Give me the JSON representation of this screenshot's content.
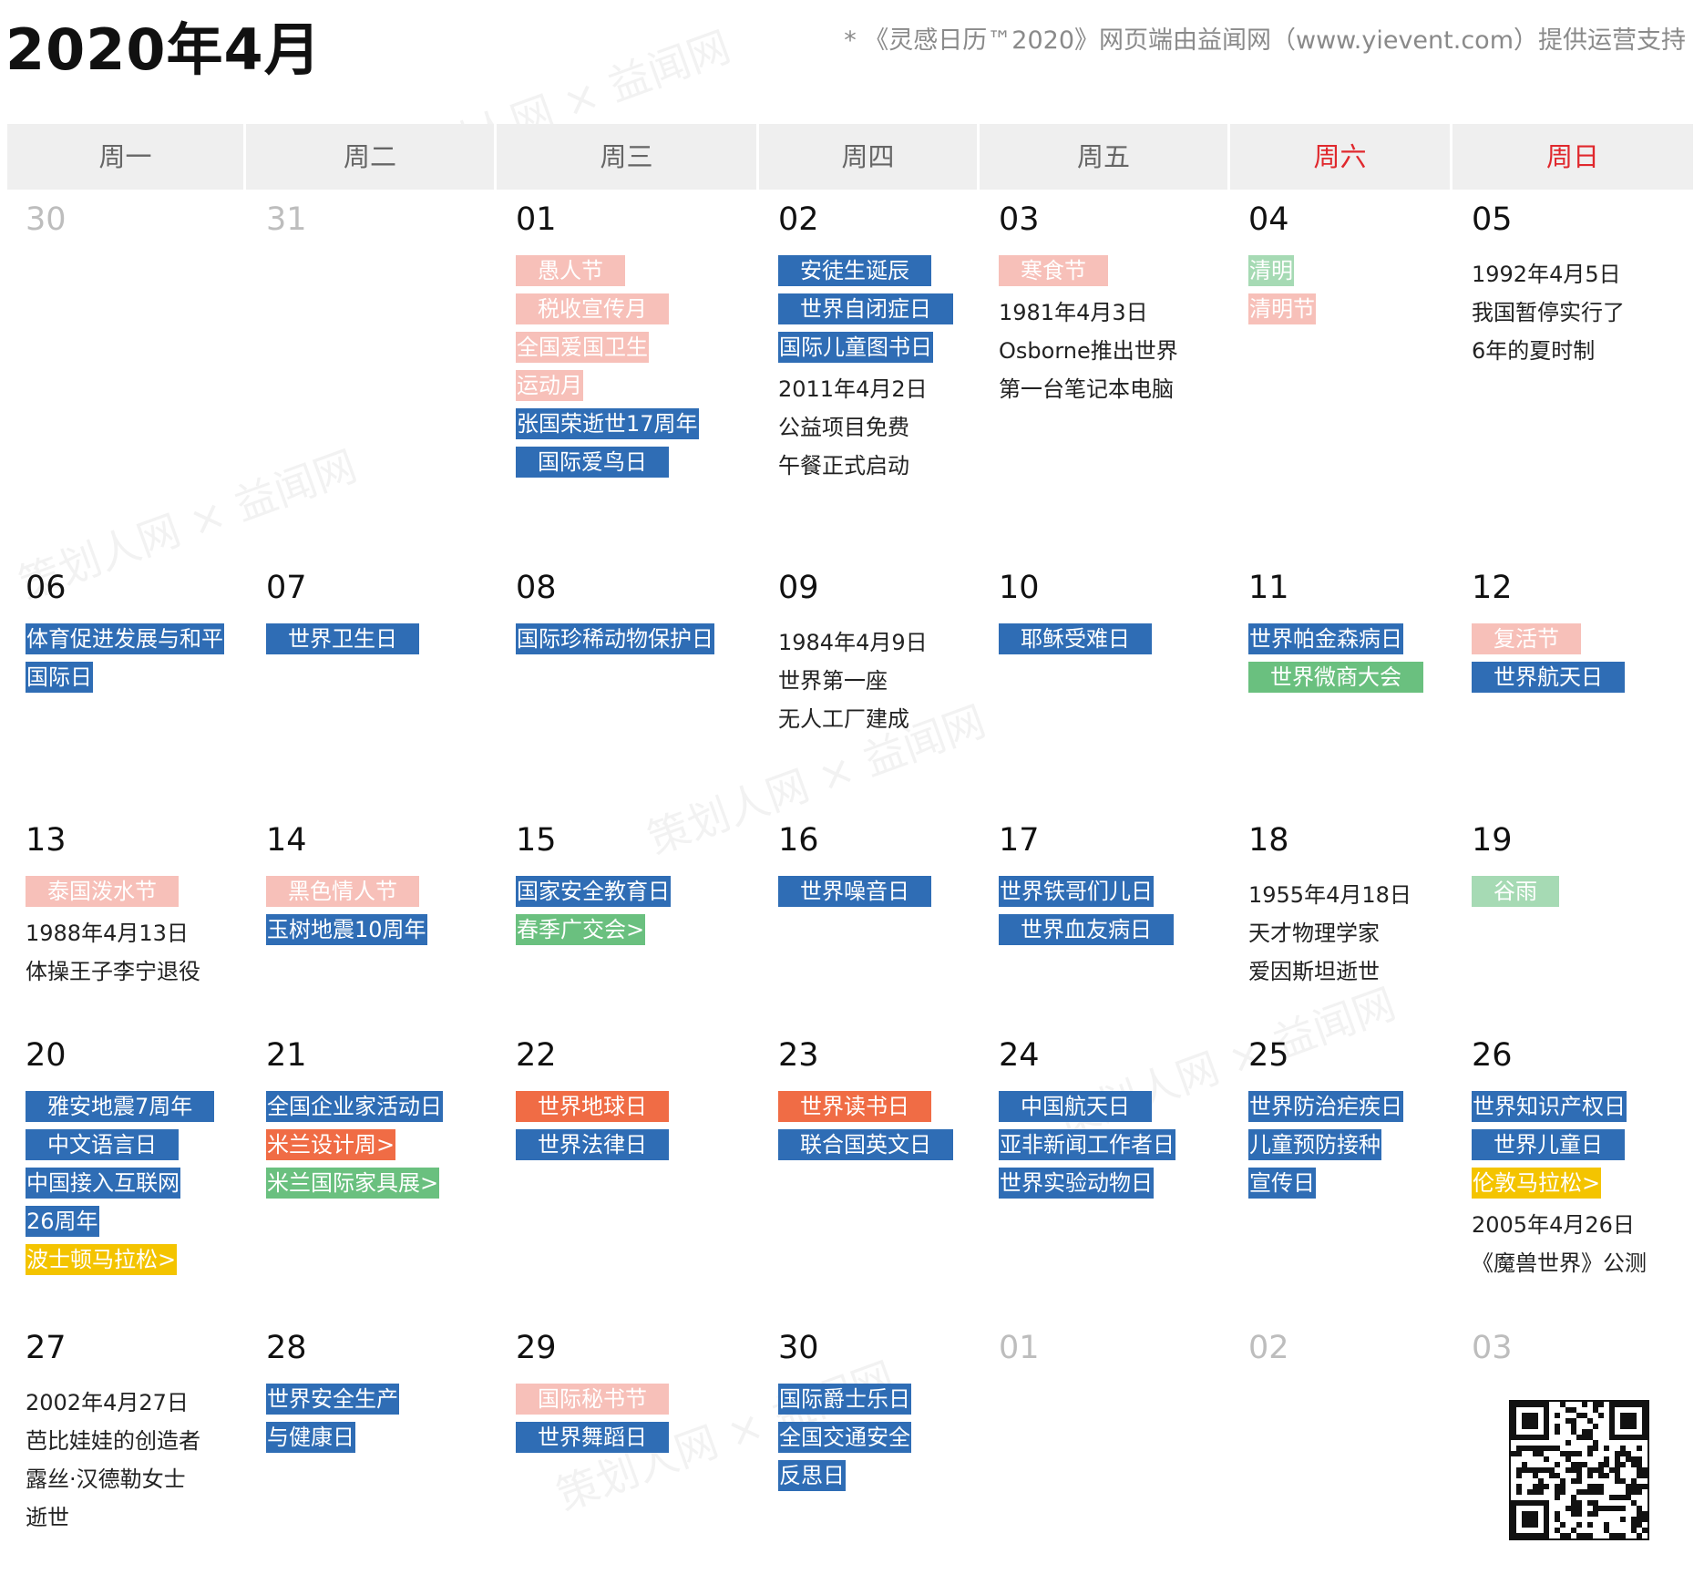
{
  "title": "2020年4月",
  "credit": "* 《灵感日历™2020》网页端由益闻网（www.yievent.com）提供运营支持",
  "weekdays": [
    "周一",
    "周二",
    "周三",
    "周四",
    "周五",
    "周六",
    "周日"
  ],
  "colors": {
    "blue": "#2f6db5",
    "pink": "#f7c0b9",
    "green": "#6ac07f",
    "light_green": "#a6dab4",
    "orange": "#f06c45",
    "yellow": "#f4c400",
    "weekend_red": "#e0282d"
  },
  "watermark": "策划人网 × 益闻网",
  "qr_icon": "qr-code-icon",
  "weeks": [
    [
      {
        "num": "30",
        "other": true,
        "tags": [],
        "notes": []
      },
      {
        "num": "31",
        "other": true,
        "tags": [],
        "notes": []
      },
      {
        "num": "01",
        "tags": [
          {
            "text": "愚人节",
            "c": "pink"
          },
          {
            "text": "税收宣传月",
            "c": "pink"
          },
          {
            "text": "全国爱国卫生",
            "c": "pink",
            "flush": true
          },
          {
            "text": "运动月",
            "c": "pink",
            "flush": true
          },
          {
            "text": "张国荣逝世17周年",
            "c": "blue",
            "flush": true
          },
          {
            "text": "国际爱鸟日",
            "c": "blue"
          }
        ],
        "notes": []
      },
      {
        "num": "02",
        "tags": [
          {
            "text": "安徒生诞辰",
            "c": "blue"
          },
          {
            "text": "世界自闭症日",
            "c": "blue"
          },
          {
            "text": "国际儿童图书日",
            "c": "blue",
            "flush": true
          }
        ],
        "notes": [
          "2011年4月2日",
          "公益项目免费",
          "午餐正式启动"
        ]
      },
      {
        "num": "03",
        "tags": [
          {
            "text": "寒食节",
            "c": "pink"
          }
        ],
        "notes": [
          "1981年4月3日",
          "Osborne推出世界",
          "第一台笔记本电脑"
        ]
      },
      {
        "num": "04",
        "tags": [
          {
            "text": "清明",
            "c": "lgreen",
            "flush": true
          },
          {
            "text": "清明节",
            "c": "pink",
            "flush": true
          }
        ],
        "notes": []
      },
      {
        "num": "05",
        "tags": [],
        "notes": [
          "1992年4月5日",
          "我国暂停实行了",
          "6年的夏时制"
        ]
      }
    ],
    [
      {
        "num": "06",
        "tags": [
          {
            "text": "体育促进发展与和平",
            "c": "blue",
            "flush": true
          },
          {
            "text": "国际日",
            "c": "blue",
            "flush": true
          }
        ],
        "notes": []
      },
      {
        "num": "07",
        "tags": [
          {
            "text": "世界卫生日",
            "c": "blue"
          }
        ],
        "notes": []
      },
      {
        "num": "08",
        "tags": [
          {
            "text": "国际珍稀动物保护日",
            "c": "blue",
            "flush": true
          }
        ],
        "notes": []
      },
      {
        "num": "09",
        "tags": [],
        "notes": [
          "1984年4月9日",
          "世界第一座",
          "无人工厂建成"
        ]
      },
      {
        "num": "10",
        "tags": [
          {
            "text": "耶稣受难日",
            "c": "blue"
          }
        ],
        "notes": []
      },
      {
        "num": "11",
        "tags": [
          {
            "text": "世界帕金森病日",
            "c": "blue",
            "flush": true
          },
          {
            "text": "世界微商大会",
            "c": "green"
          }
        ],
        "notes": []
      },
      {
        "num": "12",
        "tags": [
          {
            "text": "复活节",
            "c": "pink"
          },
          {
            "text": "世界航天日",
            "c": "blue"
          }
        ],
        "notes": []
      }
    ],
    [
      {
        "num": "13",
        "tags": [
          {
            "text": "泰国泼水节",
            "c": "pink"
          }
        ],
        "notes": [
          "1988年4月13日",
          "体操王子李宁退役"
        ]
      },
      {
        "num": "14",
        "tags": [
          {
            "text": "黑色情人节",
            "c": "pink"
          },
          {
            "text": "玉树地震10周年",
            "c": "blue",
            "flush": true
          }
        ],
        "notes": []
      },
      {
        "num": "15",
        "tags": [
          {
            "text": "国家安全教育日",
            "c": "blue",
            "flush": true
          },
          {
            "text": "春季广交会>",
            "c": "green",
            "flush": true
          }
        ],
        "notes": []
      },
      {
        "num": "16",
        "tags": [
          {
            "text": "世界噪音日",
            "c": "blue"
          }
        ],
        "notes": []
      },
      {
        "num": "17",
        "tags": [
          {
            "text": "世界铁哥们儿日",
            "c": "blue",
            "flush": true
          },
          {
            "text": "世界血友病日",
            "c": "blue"
          }
        ],
        "notes": []
      },
      {
        "num": "18",
        "tags": [],
        "notes": [
          "1955年4月18日",
          "天才物理学家",
          "爱因斯坦逝世"
        ]
      },
      {
        "num": "19",
        "tags": [
          {
            "text": "谷雨",
            "c": "lgreen"
          }
        ],
        "notes": []
      }
    ],
    [
      {
        "num": "20",
        "tags": [
          {
            "text": "雅安地震7周年",
            "c": "blue"
          },
          {
            "text": "中文语言日",
            "c": "blue"
          },
          {
            "text": "中国接入互联网",
            "c": "blue",
            "flush": true
          },
          {
            "text": "26周年",
            "c": "blue",
            "flush": true
          },
          {
            "text": "波士顿马拉松>",
            "c": "yellow",
            "flush": true
          }
        ],
        "notes": []
      },
      {
        "num": "21",
        "tags": [
          {
            "text": "全国企业家活动日",
            "c": "blue",
            "flush": true
          },
          {
            "text": "米兰设计周>",
            "c": "orange",
            "flush": true
          },
          {
            "text": "米兰国际家具展>",
            "c": "green",
            "flush": true
          }
        ],
        "notes": []
      },
      {
        "num": "22",
        "tags": [
          {
            "text": "世界地球日",
            "c": "orange"
          },
          {
            "text": "世界法律日",
            "c": "blue"
          }
        ],
        "notes": []
      },
      {
        "num": "23",
        "tags": [
          {
            "text": "世界读书日",
            "c": "orange"
          },
          {
            "text": "联合国英文日",
            "c": "blue"
          }
        ],
        "notes": []
      },
      {
        "num": "24",
        "tags": [
          {
            "text": "中国航天日",
            "c": "blue"
          },
          {
            "text": "亚非新闻工作者日",
            "c": "blue",
            "flush": true
          },
          {
            "text": "世界实验动物日",
            "c": "blue",
            "flush": true
          }
        ],
        "notes": []
      },
      {
        "num": "25",
        "tags": [
          {
            "text": "世界防治疟疾日",
            "c": "blue",
            "flush": true
          },
          {
            "text": "儿童预防接种",
            "c": "blue",
            "flush": true
          },
          {
            "text": "宣传日",
            "c": "blue",
            "flush": true
          }
        ],
        "notes": []
      },
      {
        "num": "26",
        "tags": [
          {
            "text": "世界知识产权日",
            "c": "blue",
            "flush": true
          },
          {
            "text": "世界儿童日",
            "c": "blue"
          },
          {
            "text": "伦敦马拉松>",
            "c": "yellow",
            "flush": true
          }
        ],
        "notes": [
          "2005年4月26日",
          "《魔兽世界》公测"
        ]
      }
    ],
    [
      {
        "num": "27",
        "tags": [],
        "notes": [
          "2002年4月27日",
          "芭比娃娃的创造者",
          "露丝·汉德勒女士",
          "逝世"
        ]
      },
      {
        "num": "28",
        "tags": [
          {
            "text": "世界安全生产",
            "c": "blue",
            "flush": true
          },
          {
            "text": "与健康日",
            "c": "blue",
            "flush": true
          }
        ],
        "notes": []
      },
      {
        "num": "29",
        "tags": [
          {
            "text": "国际秘书节",
            "c": "pink"
          },
          {
            "text": "世界舞蹈日",
            "c": "blue"
          }
        ],
        "notes": []
      },
      {
        "num": "30",
        "tags": [
          {
            "text": "国际爵士乐日",
            "c": "blue",
            "flush": true
          },
          {
            "text": "全国交通安全",
            "c": "blue",
            "flush": true
          },
          {
            "text": "反思日",
            "c": "blue",
            "flush": true
          }
        ],
        "notes": []
      },
      {
        "num": "01",
        "other": true,
        "tags": [],
        "notes": []
      },
      {
        "num": "02",
        "other": true,
        "tags": [],
        "notes": []
      },
      {
        "num": "03",
        "other": true,
        "tags": [],
        "notes": [],
        "qr": true
      }
    ]
  ]
}
